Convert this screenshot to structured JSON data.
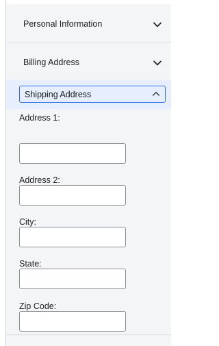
{
  "accordion": {
    "sections": [
      {
        "label": "Personal Information",
        "icon": "chevron-down-icon",
        "expanded": false
      },
      {
        "label": "Billing Address",
        "icon": "chevron-down-icon",
        "expanded": false
      },
      {
        "label": "Shipping Address",
        "icon": "chevron-up-icon",
        "expanded": true
      }
    ]
  },
  "shipping_form": {
    "fields": [
      {
        "label": "Address 1:",
        "value": ""
      },
      {
        "label": "Address 2:",
        "value": ""
      },
      {
        "label": "City:",
        "value": ""
      },
      {
        "label": "State:",
        "value": ""
      },
      {
        "label": "Zip Code:",
        "value": ""
      }
    ]
  },
  "colors": {
    "accent": "#2f6fe0",
    "active_bg": "#e7efff",
    "panel_bg": "#f4f5f7"
  }
}
